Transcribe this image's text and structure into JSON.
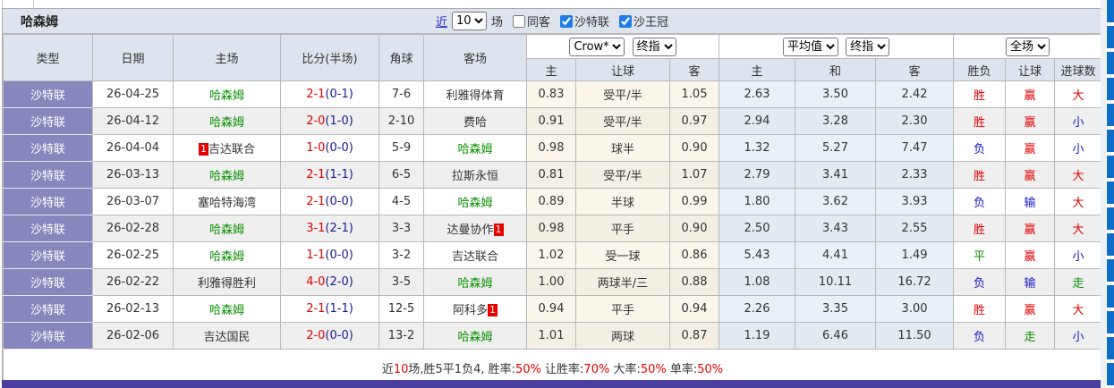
{
  "title": "哈森姆",
  "controls": {
    "recent_label": "近",
    "matches_count": "10",
    "matches_suffix": "场",
    "checkboxes": [
      {
        "label": "同客",
        "checked": false
      },
      {
        "label": "沙特联",
        "checked": true
      },
      {
        "label": "沙王冠",
        "checked": true
      }
    ]
  },
  "selects": {
    "odds_source": "Crow*",
    "odds_time": "终指",
    "average": "平均值",
    "average_time": "终指",
    "scope": "全场"
  },
  "columns": [
    "类型",
    "日期",
    "主场",
    "比分(半场)",
    "角球",
    "客场"
  ],
  "sub_columns": [
    "主",
    "让球",
    "客",
    "主",
    "和",
    "客",
    "胜负",
    "让球",
    "进球数"
  ],
  "focus_team": "哈森姆",
  "rows": [
    {
      "league": "沙特联",
      "date": "26-04-25",
      "home": "哈森姆",
      "home_badge": null,
      "score_full": "2-1",
      "score_half": "(0-1)",
      "corner": "7-6",
      "away": "利雅得体育",
      "away_badge": null,
      "odds": [
        "0.83",
        "受平/半",
        "1.05",
        "2.63",
        "3.50",
        "2.42"
      ],
      "results": [
        {
          "t": "胜",
          "c": "red"
        },
        {
          "t": "赢",
          "c": "red"
        },
        {
          "t": "大",
          "c": "red"
        }
      ]
    },
    {
      "league": "沙特联",
      "date": "26-04-12",
      "home": "哈森姆",
      "home_badge": null,
      "score_full": "2-0",
      "score_half": "(1-0)",
      "corner": "2-10",
      "away": "费哈",
      "away_badge": null,
      "odds": [
        "0.91",
        "受平/半",
        "0.97",
        "2.94",
        "3.28",
        "2.30"
      ],
      "results": [
        {
          "t": "胜",
          "c": "red"
        },
        {
          "t": "赢",
          "c": "red"
        },
        {
          "t": "小",
          "c": "blue"
        }
      ]
    },
    {
      "league": "沙特联",
      "date": "26-04-04",
      "home": "吉达联合",
      "home_badge": {
        "text": "1",
        "pos": "before"
      },
      "score_full": "1-0",
      "score_half": "(0-0)",
      "corner": "5-9",
      "away": "哈森姆",
      "away_badge": null,
      "odds": [
        "0.98",
        "球半",
        "0.90",
        "1.32",
        "5.27",
        "7.47"
      ],
      "results": [
        {
          "t": "负",
          "c": "blue"
        },
        {
          "t": "赢",
          "c": "red"
        },
        {
          "t": "小",
          "c": "blue"
        }
      ]
    },
    {
      "league": "沙特联",
      "date": "26-03-13",
      "home": "哈森姆",
      "home_badge": null,
      "score_full": "2-1",
      "score_half": "(1-1)",
      "corner": "6-5",
      "away": "拉斯永恒",
      "away_badge": null,
      "odds": [
        "0.81",
        "受平/半",
        "1.07",
        "2.79",
        "3.41",
        "2.33"
      ],
      "results": [
        {
          "t": "胜",
          "c": "red"
        },
        {
          "t": "赢",
          "c": "red"
        },
        {
          "t": "大",
          "c": "red"
        }
      ]
    },
    {
      "league": "沙特联",
      "date": "26-03-07",
      "home": "塞哈特海湾",
      "home_badge": null,
      "score_full": "2-1",
      "score_half": "(0-0)",
      "corner": "4-5",
      "away": "哈森姆",
      "away_badge": null,
      "odds": [
        "0.89",
        "半球",
        "0.99",
        "1.80",
        "3.62",
        "3.93"
      ],
      "results": [
        {
          "t": "负",
          "c": "blue"
        },
        {
          "t": "输",
          "c": "blue"
        },
        {
          "t": "大",
          "c": "red"
        }
      ]
    },
    {
      "league": "沙特联",
      "date": "26-02-28",
      "home": "哈森姆",
      "home_badge": null,
      "score_full": "3-1",
      "score_half": "(2-1)",
      "corner": "3-3",
      "away": "达曼协作",
      "away_badge": {
        "text": "1",
        "pos": "after"
      },
      "odds": [
        "0.98",
        "平手",
        "0.90",
        "2.50",
        "3.43",
        "2.55"
      ],
      "results": [
        {
          "t": "胜",
          "c": "red"
        },
        {
          "t": "赢",
          "c": "red"
        },
        {
          "t": "大",
          "c": "red"
        }
      ]
    },
    {
      "league": "沙特联",
      "date": "26-02-25",
      "home": "哈森姆",
      "home_badge": null,
      "score_full": "1-1",
      "score_half": "(0-0)",
      "corner": "3-2",
      "away": "吉达联合",
      "away_badge": null,
      "odds": [
        "1.02",
        "受一球",
        "0.86",
        "5.43",
        "4.41",
        "1.49"
      ],
      "results": [
        {
          "t": "平",
          "c": "green"
        },
        {
          "t": "赢",
          "c": "red"
        },
        {
          "t": "小",
          "c": "blue"
        }
      ]
    },
    {
      "league": "沙特联",
      "date": "26-02-22",
      "home": "利雅得胜利",
      "home_badge": null,
      "score_full": "4-0",
      "score_half": "(2-0)",
      "corner": "3-5",
      "away": "哈森姆",
      "away_badge": null,
      "odds": [
        "1.00",
        "两球半/三",
        "0.88",
        "1.08",
        "10.11",
        "16.72"
      ],
      "results": [
        {
          "t": "负",
          "c": "blue"
        },
        {
          "t": "输",
          "c": "blue"
        },
        {
          "t": "走",
          "c": "green"
        }
      ]
    },
    {
      "league": "沙特联",
      "date": "26-02-13",
      "home": "哈森姆",
      "home_badge": null,
      "score_full": "2-1",
      "score_half": "(1-1)",
      "corner": "12-5",
      "away": "阿科多",
      "away_badge": {
        "text": "1",
        "pos": "after"
      },
      "odds": [
        "0.94",
        "平手",
        "0.94",
        "2.26",
        "3.35",
        "3.00"
      ],
      "results": [
        {
          "t": "胜",
          "c": "red"
        },
        {
          "t": "赢",
          "c": "red"
        },
        {
          "t": "大",
          "c": "red"
        }
      ]
    },
    {
      "league": "沙特联",
      "date": "26-02-06",
      "home": "吉达国民",
      "home_badge": null,
      "score_full": "2-0",
      "score_half": "(0-0)",
      "corner": "13-2",
      "away": "哈森姆",
      "away_badge": null,
      "odds": [
        "1.01",
        "两球",
        "0.87",
        "1.19",
        "6.46",
        "11.50"
      ],
      "results": [
        {
          "t": "负",
          "c": "blue"
        },
        {
          "t": "走",
          "c": "green"
        },
        {
          "t": "小",
          "c": "blue"
        }
      ]
    }
  ],
  "footer_segments": [
    {
      "t": "近",
      "c": "black"
    },
    {
      "t": "10",
      "c": "red"
    },
    {
      "t": "场,胜5平1负4, 胜率:",
      "c": "black"
    },
    {
      "t": "50%",
      "c": "red"
    },
    {
      "t": " 让胜率:",
      "c": "black"
    },
    {
      "t": "70%",
      "c": "red"
    },
    {
      "t": " 大率:",
      "c": "black"
    },
    {
      "t": "50%",
      "c": "red"
    },
    {
      "t": " 单率:",
      "c": "black"
    },
    {
      "t": "50%",
      "c": "red"
    }
  ],
  "colors": {
    "win_red": "#e60000",
    "loss_blue": "#1515cc",
    "draw_green": "#089000",
    "focus_team_green": "#089000",
    "league_cell_purple": "#8787bd",
    "header_bg": "#dde4ed",
    "odds_col_cream_bg": "#faf6ec",
    "avg_col_blue_bg": "#e8f1f8",
    "divider_purple": "#4a3f9f",
    "right_strip_blue": "#0d6ec9"
  }
}
